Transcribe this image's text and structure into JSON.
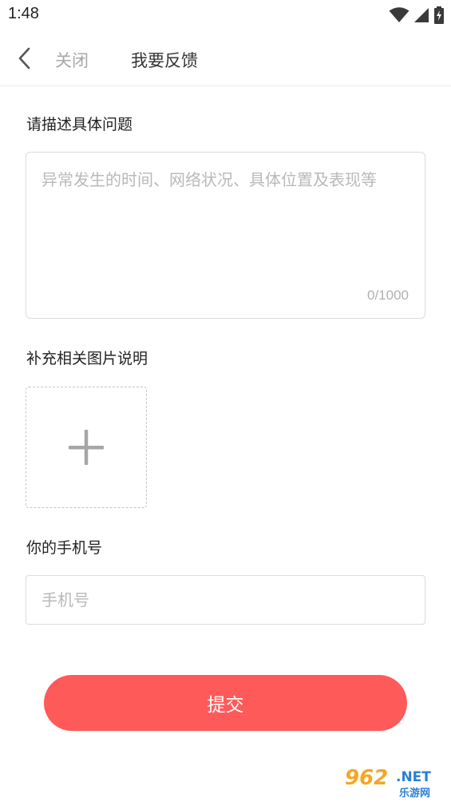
{
  "status_bar": {
    "time": "1:48",
    "icons": [
      "wifi-icon",
      "signal-icon",
      "battery-icon"
    ]
  },
  "nav": {
    "back_icon": "chevron-left-icon",
    "close_label": "关闭",
    "title": "我要反馈"
  },
  "description": {
    "label": "请描述具体问题",
    "placeholder": "异常发生的时间、网络状况、具体位置及表现等",
    "value": "",
    "counter": "0/1000"
  },
  "images": {
    "label": "补充相关图片说明",
    "add_icon": "plus-icon"
  },
  "phone": {
    "label": "你的手机号",
    "placeholder": "手机号",
    "value": ""
  },
  "submit": {
    "label": "提交",
    "color": "#ff5a5a"
  },
  "watermark": {
    "text_main": "962.NET",
    "text_sub": "乐游网",
    "colors": {
      "orange": "#f5a623",
      "blue": "#2a7fd6"
    }
  }
}
